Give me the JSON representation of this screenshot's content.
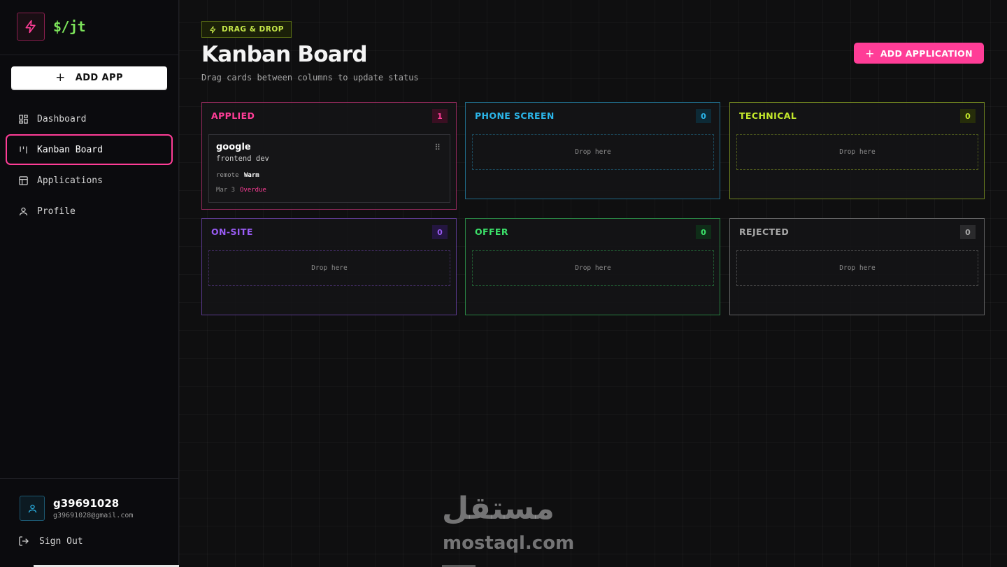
{
  "app": {
    "brand": "$/jt"
  },
  "sidebar": {
    "add_button": "ADD APP",
    "items": [
      {
        "label": "Dashboard",
        "icon": "dashboard-icon",
        "active": false
      },
      {
        "label": "Kanban Board",
        "icon": "kanban-icon",
        "active": true
      },
      {
        "label": "Applications",
        "icon": "table-icon",
        "active": false
      },
      {
        "label": "Profile",
        "icon": "user-icon",
        "active": false
      }
    ],
    "user": {
      "name": "g39691028",
      "email": "g39691028@gmail.com"
    },
    "sign_out": "Sign Out"
  },
  "header": {
    "tag": "DRAG & DROP",
    "title": "Kanban Board",
    "subtitle": "Drag cards between columns to update status",
    "add_button": "ADD APPLICATION"
  },
  "columns": [
    {
      "title": "APPLIED",
      "count": "1",
      "color": "#ff3d97",
      "count_bg": "#3a0f22",
      "cards": [
        {
          "company": "google",
          "role": "frontend dev",
          "location": "remote",
          "temperature": "Warm",
          "date": "Mar 3",
          "status": "Overdue"
        }
      ]
    },
    {
      "title": "PHONE SCREEN",
      "count": "0",
      "color": "#2bb6ea",
      "count_bg": "#0d2a36",
      "drop_text": "Drop here",
      "cards": []
    },
    {
      "title": "TECHNICAL",
      "count": "0",
      "color": "#c3e82b",
      "count_bg": "#262d0a",
      "drop_text": "Drop here",
      "cards": []
    },
    {
      "title": "ON-SITE",
      "count": "0",
      "color": "#9a5cf5",
      "count_bg": "#241640",
      "drop_text": "Drop here",
      "cards": []
    },
    {
      "title": "OFFER",
      "count": "0",
      "color": "#3ce36a",
      "count_bg": "#0f2d18",
      "drop_text": "Drop here",
      "cards": []
    },
    {
      "title": "REJECTED",
      "count": "0",
      "color": "#a8a8a8",
      "count_bg": "#2a2a2c",
      "drop_text": "Drop here",
      "cards": []
    }
  ],
  "watermark": {
    "arabic": "مستقل",
    "latin": "mostaql.com"
  }
}
